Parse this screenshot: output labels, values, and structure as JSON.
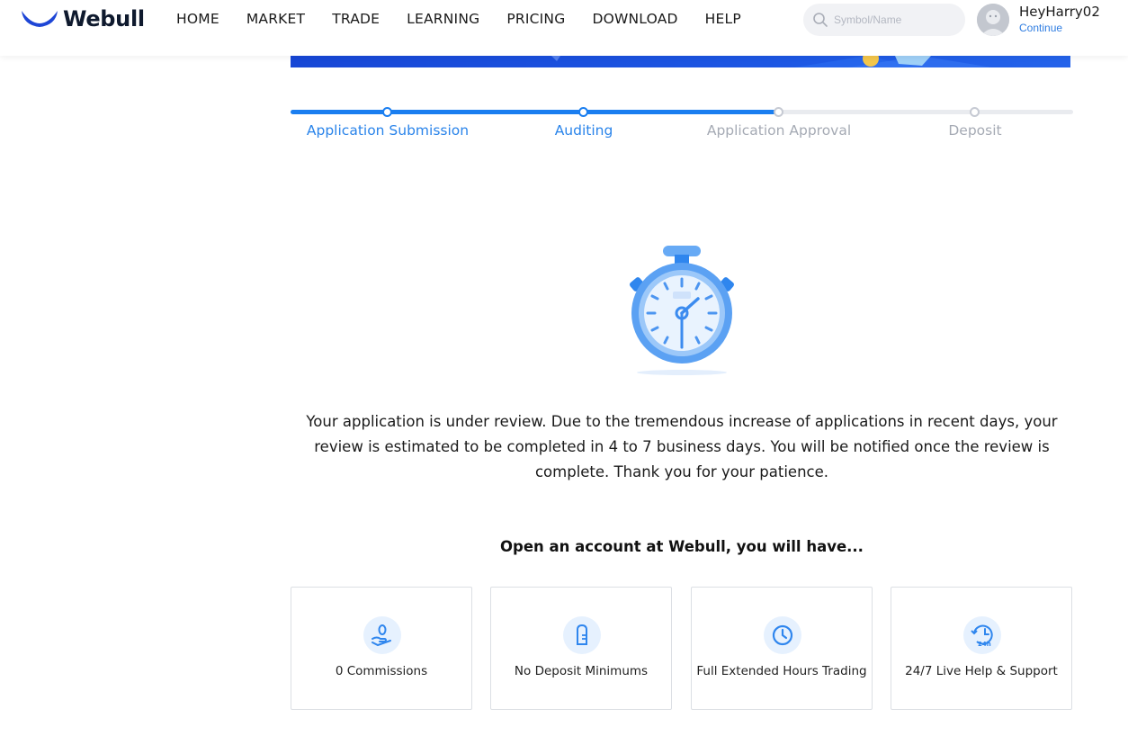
{
  "brand": {
    "name": "Webull"
  },
  "nav": [
    "HOME",
    "MARKET",
    "TRADE",
    "LEARNING",
    "PRICING",
    "DOWNLOAD",
    "HELP"
  ],
  "search": {
    "placeholder": "Symbol/Name"
  },
  "user": {
    "name": "HeyHarry02",
    "action": "Continue"
  },
  "progress": {
    "completed_steps": 2,
    "steps": [
      "Application Submission",
      "Auditing",
      "Application Approval",
      "Deposit"
    ]
  },
  "status_message": "Your application is under review. Due to the tremendous increase of applications in recent days, your review is estimated to be completed in 4 to 7 business days. You will be notified once the review is complete. Thank you for your patience.",
  "benefits": {
    "title": "Open an account at Webull, you will have...",
    "items": [
      {
        "label": "0 Commissions",
        "icon": "zero-commission-hand-icon"
      },
      {
        "label": "No Deposit Minimums",
        "icon": "no-deposit-icon"
      },
      {
        "label": "Full Extended Hours Trading",
        "icon": "clock-icon"
      },
      {
        "label": "24/7 Live Help & Support",
        "icon": "24h-support-icon"
      }
    ]
  },
  "colors": {
    "accent": "#1a7ef0",
    "inactive": "#a5aab4",
    "banner": "#1c56e3",
    "icon_bg": "#e6f1fe"
  }
}
